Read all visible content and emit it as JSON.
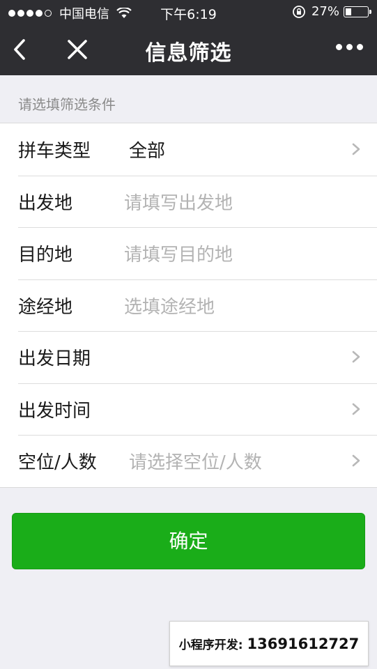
{
  "status_bar": {
    "carrier": "中国电信",
    "time": "下午6:19",
    "battery": "27%",
    "battery_level": 0.27
  },
  "nav": {
    "title": "信息筛选",
    "back_icon": "chevron-left-icon",
    "close_icon": "close-icon",
    "more_icon": "more-dots-icon"
  },
  "form": {
    "hint": "请选填筛选条件",
    "rows": [
      {
        "label": "拼车类型",
        "value": "全部"
      },
      {
        "label": "出发地",
        "placeholder": "请填写出发地"
      },
      {
        "label": "目的地",
        "placeholder": "请填写目的地"
      },
      {
        "label": "途经地",
        "placeholder": "选填途经地"
      },
      {
        "label": "出发日期"
      },
      {
        "label": "出发时间"
      },
      {
        "label": "空位/人数",
        "placeholder": "请选择空位/人数"
      }
    ]
  },
  "confirm_label": "确定",
  "promo": {
    "label": "小程序开发:",
    "phone": "13691612727"
  },
  "colors": {
    "nav_background": "#2e2e32",
    "page_background": "#efeff4",
    "primary_green": "#1aad19",
    "placeholder_gray": "#b3b3b3"
  }
}
